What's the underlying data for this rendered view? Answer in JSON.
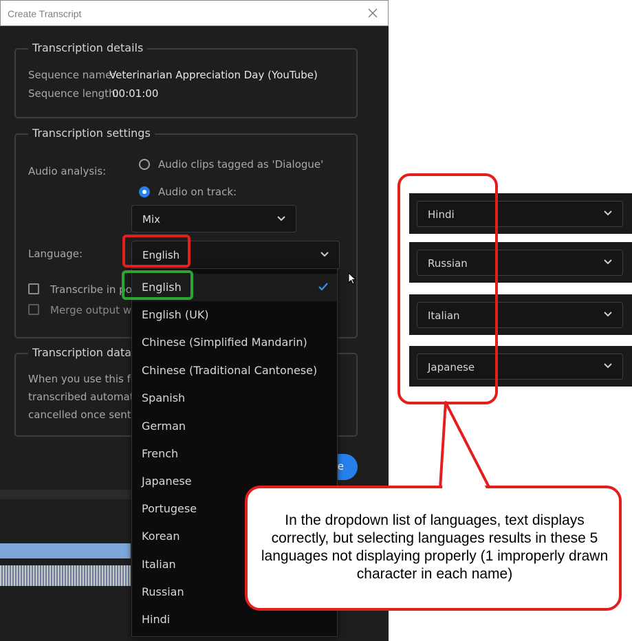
{
  "dialog": {
    "title": "Create Transcript",
    "details": {
      "heading": "Transcription details",
      "seq_name_label": "Sequence name:",
      "seq_name_value": "Veterinarian Appreciation Day (YouTube)",
      "seq_length_label": "Sequence length:",
      "seq_length_value": "00:01:00"
    },
    "settings": {
      "heading": "Transcription settings",
      "audio_analysis_label": "Audio analysis:",
      "radio_dialogue": "Audio clips tagged as 'Dialogue'",
      "radio_track": "Audio on track:",
      "track_select": "Mix",
      "language_label": "Language:",
      "language_select": "English",
      "checkbox_1": "Transcribe in poi",
      "checkbox_2": "Merge output wit"
    },
    "data_section": {
      "heading": "Transcription data",
      "line1": "When you use this fea",
      "line2": "transcribed automatic",
      "line3": "cancelled once sent fo"
    },
    "button_partial": "e"
  },
  "dropdown": {
    "selected_index": 0,
    "items": [
      "English",
      "English (UK)",
      "Chinese (Simplified Mandarin)",
      "Chinese (Traditional Cantonese)",
      "Spanish",
      "German",
      "French",
      "Japanese",
      "Portugese",
      "Korean",
      "Italian",
      "Russian",
      "Hindi"
    ]
  },
  "chips": [
    "Hindi",
    "Russian",
    "Italian",
    "Japanese"
  ],
  "callout_text": "In the dropdown list of languages, text displays correctly, but selecting languages results in these 5 languages not displaying properly (1 improperly drawn character in each name)",
  "colors": {
    "accent": "#2680eb",
    "highlight_red": "#e41d1d",
    "highlight_green": "#2ea52e",
    "dialog_bg": "#1e1e1e"
  }
}
